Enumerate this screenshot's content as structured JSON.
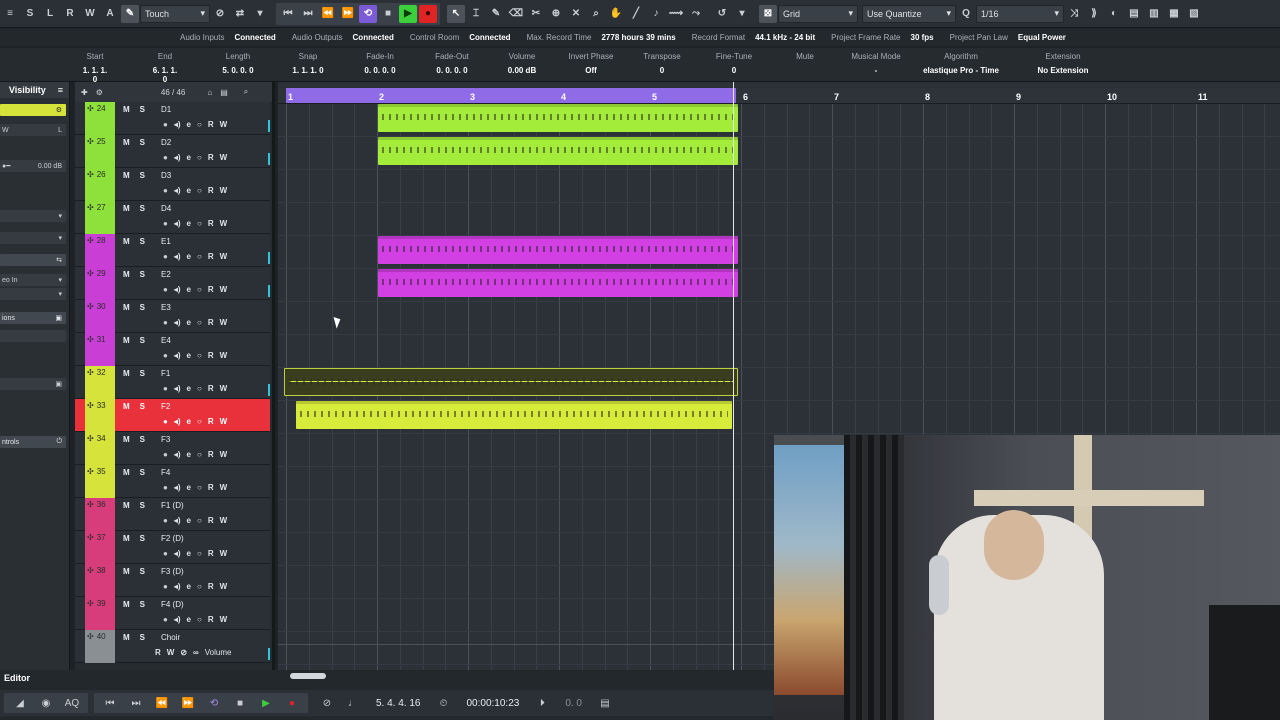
{
  "toolbar": {
    "left_letters": [
      "S",
      "L",
      "R",
      "W",
      "A"
    ],
    "automation_mode": "Touch",
    "grid_type": "Grid",
    "quantize_mode": "Use Quantize",
    "quantize_value": "1/16"
  },
  "status": [
    {
      "label": "Audio Inputs",
      "value": "Connected"
    },
    {
      "label": "Audio Outputs",
      "value": "Connected"
    },
    {
      "label": "Control Room",
      "value": "Connected"
    },
    {
      "label": "Max. Record Time",
      "value": "2778 hours 39 mins"
    },
    {
      "label": "Record Format",
      "value": "44.1 kHz - 24 bit"
    },
    {
      "label": "Project Frame Rate",
      "value": "30 fps"
    },
    {
      "label": "Project Pan Law",
      "value": "Equal Power"
    }
  ],
  "infoline": [
    {
      "header": "Start",
      "value": "1. 1. 1. 0"
    },
    {
      "header": "End",
      "value": "6. 1. 1. 0"
    },
    {
      "header": "Length",
      "value": "5. 0. 0. 0"
    },
    {
      "header": "Snap",
      "value": "1. 1. 1. 0"
    },
    {
      "header": "Fade-In",
      "value": "0. 0. 0. 0"
    },
    {
      "header": "Fade-Out",
      "value": "0. 0. 0. 0"
    },
    {
      "header": "Volume",
      "value": "0.00  dB"
    },
    {
      "header": "Invert Phase",
      "value": "Off"
    },
    {
      "header": "Transpose",
      "value": "0"
    },
    {
      "header": "Fine-Tune",
      "value": "0"
    },
    {
      "header": "Mute",
      "value": ""
    },
    {
      "header": "Musical Mode",
      "value": "-"
    },
    {
      "header": "Algorithm",
      "value": "elastique Pro - Time"
    },
    {
      "header": "Extension",
      "value": "No Extension"
    }
  ],
  "inspector": {
    "title": "Visibility",
    "volume_readout": "0.00 dB",
    "routing": "eo In",
    "section_1": "ions",
    "section_2": "ntrols",
    "letters": [
      "W",
      "L"
    ]
  },
  "tracklist": {
    "count": "46 / 46"
  },
  "tracks": [
    {
      "num": "24",
      "name": "D1",
      "color": "#8ee03a"
    },
    {
      "num": "25",
      "name": "D2",
      "color": "#8ee03a"
    },
    {
      "num": "26",
      "name": "D3",
      "color": "#8ee03a"
    },
    {
      "num": "27",
      "name": "D4",
      "color": "#8ee03a"
    },
    {
      "num": "28",
      "name": "E1",
      "color": "#c93fd6"
    },
    {
      "num": "29",
      "name": "E2",
      "color": "#c93fd6"
    },
    {
      "num": "30",
      "name": "E3",
      "color": "#c93fd6"
    },
    {
      "num": "31",
      "name": "E4",
      "color": "#c93fd6"
    },
    {
      "num": "32",
      "name": "F1",
      "color": "#d6e33b"
    },
    {
      "num": "33",
      "name": "F2",
      "color": "#d6e33b"
    },
    {
      "num": "34",
      "name": "F3",
      "color": "#d6e33b"
    },
    {
      "num": "35",
      "name": "F4",
      "color": "#d6e33b"
    },
    {
      "num": "36",
      "name": "F1 (D)",
      "color": "#d83d7b"
    },
    {
      "num": "37",
      "name": "F2 (D)",
      "color": "#d83d7b"
    },
    {
      "num": "38",
      "name": "F3 (D)",
      "color": "#d83d7b"
    },
    {
      "num": "39",
      "name": "F4 (D)",
      "color": "#d83d7b"
    },
    {
      "num": "40",
      "name": "Choir",
      "color": "#8a8f94"
    }
  ],
  "track_controls": {
    "mute": "M",
    "solo": "S",
    "read": "R",
    "write": "W",
    "volume_label": "Volume"
  },
  "ruler": {
    "bars": [
      "1",
      "2",
      "3",
      "4",
      "5",
      "6",
      "7",
      "8",
      "9",
      "10",
      "11"
    ]
  },
  "transport": {
    "position": "5. 4. 4. 16",
    "time": "00:00:10:23",
    "counter": "0.   0"
  },
  "bottom": {
    "editor_tab": "Editor"
  },
  "colors": {
    "green": "#a4ec3a",
    "magenta": "#d23fe3",
    "yellow": "#d7ec3a",
    "red": "#e8313a",
    "cycle": "#8f6be8"
  }
}
